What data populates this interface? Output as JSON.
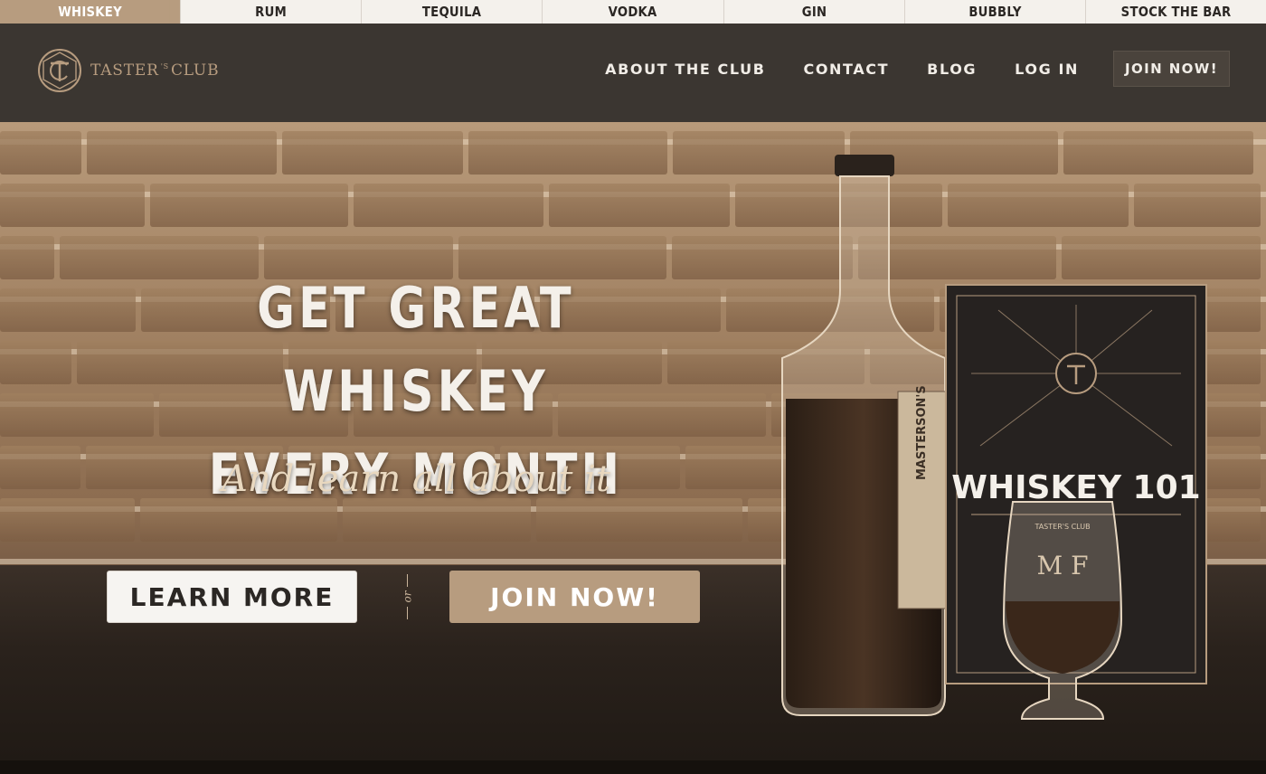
{
  "categories": [
    {
      "label": "WHISKEY",
      "active": true
    },
    {
      "label": "RUM",
      "active": false
    },
    {
      "label": "TEQUILA",
      "active": false
    },
    {
      "label": "VODKA",
      "active": false
    },
    {
      "label": "GIN",
      "active": false
    },
    {
      "label": "BUBBLY",
      "active": false
    },
    {
      "label": "STOCK THE BAR",
      "active": false
    }
  ],
  "header": {
    "logo_text_1": "TASTER",
    "logo_text_sup": "'S",
    "logo_text_2": "CLUB",
    "nav": [
      "ABOUT THE CLUB",
      "CONTACT",
      "BLOG",
      "LOG IN"
    ],
    "join_label": "JOIN NOW!"
  },
  "hero": {
    "headline_1": "GET GREAT WHISKEY",
    "headline_2": "EVERY MONTH",
    "subhead": "And learn all about it",
    "learn_more": "LEARN MORE",
    "or_text": "or",
    "join_now": "JOIN NOW!",
    "book_title": "WHISKEY 101",
    "bottle_label": "MASTERSON'S",
    "glass_monogram": "M F",
    "glass_brand": "TASTER'S CLUB"
  },
  "colors": {
    "accent": "#b79c7f",
    "header_bg": "#3b3631",
    "strip_bg": "#f4f1ec",
    "text_dark": "#2b2724"
  },
  "icons": [
    "taster-club-logo-icon",
    "bottle-image",
    "book-image",
    "glass-image"
  ]
}
